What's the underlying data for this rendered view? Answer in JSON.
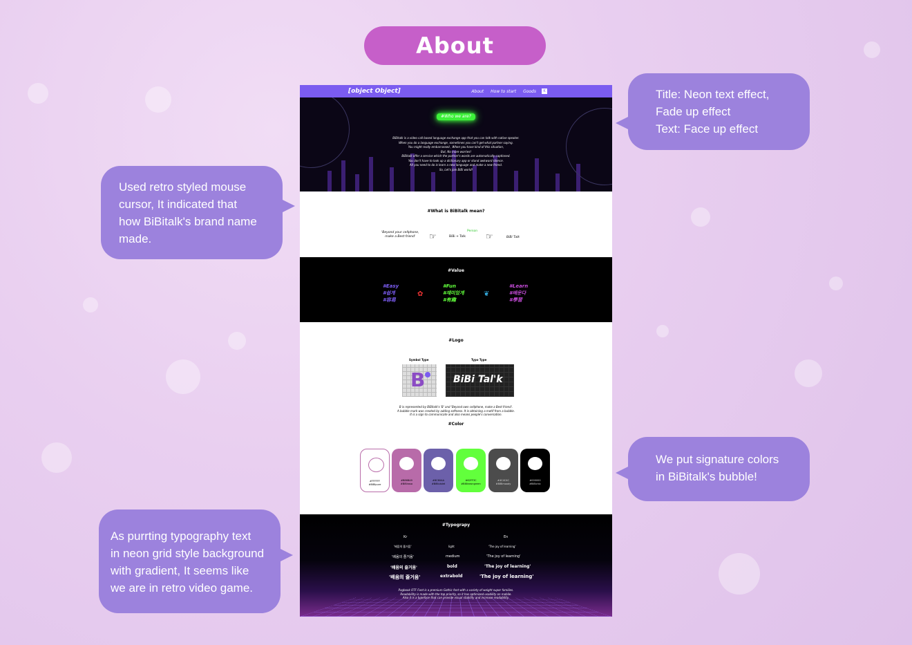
{
  "header": {
    "title": "About"
  },
  "callouts": {
    "title_effect": "Title: Neon text effect,\n Fade up effect\nText: Face up effect",
    "cursor": "Used retro styled mouse\ncursor, It indicated that\nhow BiBitalk's brand name\nmade.",
    "colors": "We put signature colors\nin BiBitalk's bubble!",
    "typography": "As purrting typography text\nin neon grid style background\nwith gradient, It seems like\nwe are in retro video game."
  },
  "site": {
    "logo": {
      "title": "#Logo",
      "symbol_label": "Symbol Type",
      "typo_label": "Typo Type",
      "typo_text": "BiBi Tal'k",
      "symbol_text": "B",
      "desc": "B is represented by BiBitalk's 'B' and 'Beyond own cellphone, make a Best friend'.\nA bubble mark was created by adding softness. It is obtaining a motif from a bubble.\nIt is a sign to communicate and also means people's conversation."
    },
    "nav": [
      "About",
      "How to start",
      "Goods"
    ],
    "hero": {
      "neon_title": "#Who we are?",
      "text": "BiBitalk is a video call based language exchange app that you can talk with native speaker.\nWhen you do a language exchange, sometimes you can't get what partner saying.\nYou might really embarrassed , When you have kind of this situation,\nBut, No more worries!\nBiBitalk offer a service which the partner's words are automatically captioned.\nYou don't have to look up a dictionary app or stand awkward silence.\nAll you need to do is learn a new language and make a new friend.\nSo, Let's join BiBi world!"
    },
    "what": {
      "title": "#What is BiBitalk mean?",
      "quote": "'Beyond your cellphone,\nmake a Best friend'",
      "formula": "BiBi + Talk",
      "person": "Person",
      "result": "BiBi Talk"
    },
    "value": {
      "title": "#Value",
      "cols": [
        {
          "en": "#Easy",
          "kr": "#쉽게",
          "cn": "#容易",
          "color": "#7b5cf0"
        },
        {
          "en": "#Fun",
          "kr": "#재미있게",
          "cn": "#有趣",
          "color": "#62ff3c"
        },
        {
          "en": "#Learn",
          "kr": "#배운다",
          "cn": "#學習",
          "color": "#c34bd6"
        }
      ]
    },
    "color": {
      "title": "#Color",
      "swatches": [
        {
          "hex": "#FFFFFF",
          "name": "#BIBIpure",
          "bg": "#FFFFFF",
          "bubble": "#FFFFFF"
        },
        {
          "hex": "#B86BA9",
          "name": "#BiBirosa",
          "bg": "#B86BA9",
          "bubble": "#FFFFFF"
        },
        {
          "hex": "#6C60AA",
          "name": "#BiBiviolet",
          "bg": "#6C60AA",
          "bubble": "#FFFFFF"
        },
        {
          "hex": "#62FF3C",
          "name": "#BiBineongreen",
          "bg": "#62FF3C",
          "bubble": "#FFFFFF"
        },
        {
          "hex": "#4C4C4C",
          "name": "#BiBimoody",
          "bg": "#4C4C4C",
          "bubble": "#FFFFFF"
        },
        {
          "hex": "#000000",
          "name": "#BiBichic",
          "bg": "#000000",
          "bubble": "#FFFFFF"
        }
      ]
    },
    "typography": {
      "title": "#Typograpy",
      "kr_head": "Kr",
      "en_head": "En",
      "rows": [
        {
          "kr": "'배움의 즐거움'",
          "weight": "light",
          "en": "'The joy of learning'"
        },
        {
          "kr": "'배움의 즐거움'",
          "weight": "medium",
          "en": "'The joy of learning'"
        },
        {
          "kr": "'배움의 즐거움'",
          "weight": "bold",
          "en": "'The joy of learning'"
        },
        {
          "kr": "'배움의 즐거움'",
          "weight": "extrabold",
          "en": "'The joy of learning'"
        }
      ],
      "desc": "Pagbook OTF Font is a premium Gothic font with a variety of weight super families.\nReadability is made with the top priority, so it has optimized usability on mobile.\nAlso it is a typeface that can provide visual stability and increase readability."
    }
  }
}
